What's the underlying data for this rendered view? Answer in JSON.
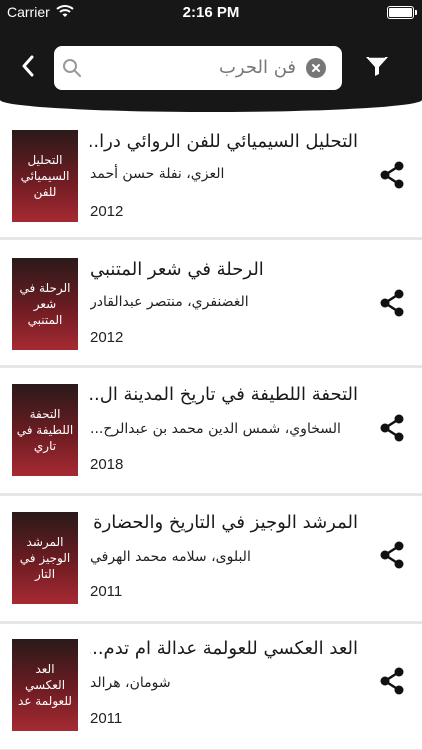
{
  "status_bar": {
    "carrier": "Carrier",
    "time": "2:16 PM",
    "battery_level": 1.0
  },
  "header": {
    "back_icon": "chevron-left-icon",
    "search": {
      "value": "فن الحرب",
      "search_icon": "magnifier-icon",
      "clear_icon": "clear-circle-icon"
    },
    "filter_icon": "funnel-icon"
  },
  "colors": {
    "header_bg": "#171717",
    "cover_gradient_top": "#2a1a1a",
    "cover_gradient_bottom": "#a62a33",
    "divider": "#e6e6e6"
  },
  "books": [
    {
      "title": "التحليل السيميائي للفن الروائي درا...",
      "author": "العزي، نفلة حسن أحمد",
      "year": "2012",
      "cover_text": "التحليل السيميائي للفن"
    },
    {
      "title": "الرحلة في شعر المتنبي",
      "author": "الغضنفري، منتصر عبدالقادر",
      "year": "2012",
      "cover_text": "الرحلة في شعر المتنبي"
    },
    {
      "title": "التحفة اللطيفة في تاريخ المدينة ال...",
      "author": "السخاوي، شمس الدين محمد بن عبدالرح...",
      "year": "2018",
      "cover_text": "التحفة اللطيفة في تاري"
    },
    {
      "title": "المرشد الوجيز في التاريخ والحضارة ا...",
      "author": "البلوى، سلامه محمد الهرفي",
      "year": "2011",
      "cover_text": "المرشد الوجيز في التار"
    },
    {
      "title": "العد العكسي للعولمة عدالة ام تدم...",
      "author": "شومان، هرالد",
      "year": "2011",
      "cover_text": "العد العكسي للعولمة عد"
    }
  ]
}
